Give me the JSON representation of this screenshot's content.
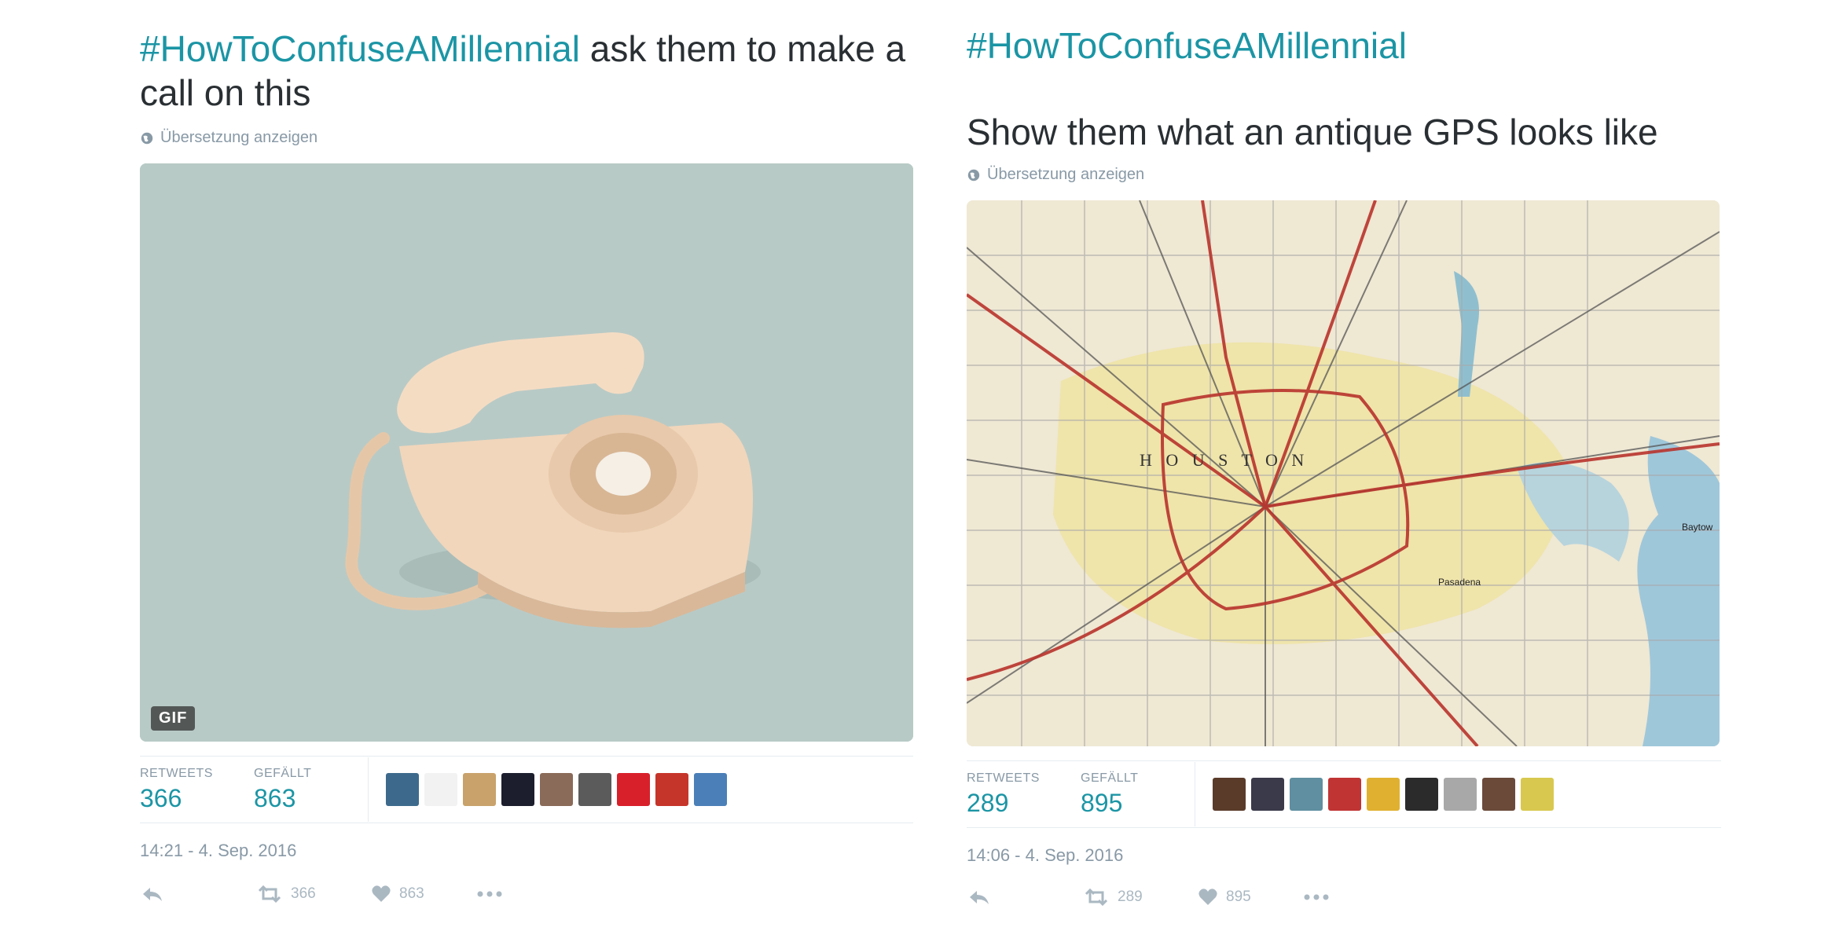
{
  "colors": {
    "hashtag": "#1b95a5",
    "text": "#292f33",
    "muted": "#8899a6",
    "stat_value": "#1b95a5"
  },
  "tweets": [
    {
      "hashtag": "#HowToConfuseAMillennial",
      "text": " ask them to make a call on this",
      "translate": "Übersetzung anzeigen",
      "media_badge": "GIF",
      "stats": {
        "retweets_label": "RETWEETS",
        "retweets": "366",
        "likes_label": "GEFÄLLT",
        "likes": "863"
      },
      "timestamp": "14:21 - 4. Sep. 2016",
      "actions": {
        "retweet_count": "366",
        "like_count": "863"
      },
      "avatar_colors": [
        "#3d6a8c",
        "#f2f2f2",
        "#c9a26b",
        "#1c1e2e",
        "#8a6a58",
        "#5b5b5b",
        "#d8202b",
        "#c6352a",
        "#4b7fb8"
      ]
    },
    {
      "hashtag": "#HowToConfuseAMillennial",
      "text": "Show them what an antique GPS looks like",
      "translate": "Übersetzung anzeigen",
      "map_labels": {
        "city": "H O U S T O N",
        "pasadena": "Pasadena",
        "baytown": "Baytow"
      },
      "stats": {
        "retweets_label": "RETWEETS",
        "retweets": "289",
        "likes_label": "GEFÄLLT",
        "likes": "895"
      },
      "timestamp": "14:06 - 4. Sep. 2016",
      "actions": {
        "retweet_count": "289",
        "like_count": "895"
      },
      "avatar_colors": [
        "#5a3b2a",
        "#3a3a4a",
        "#5f8fa0",
        "#c03434",
        "#e0b030",
        "#2b2b2b",
        "#a8a8a8",
        "#6b4a3a",
        "#d8c850"
      ]
    }
  ]
}
